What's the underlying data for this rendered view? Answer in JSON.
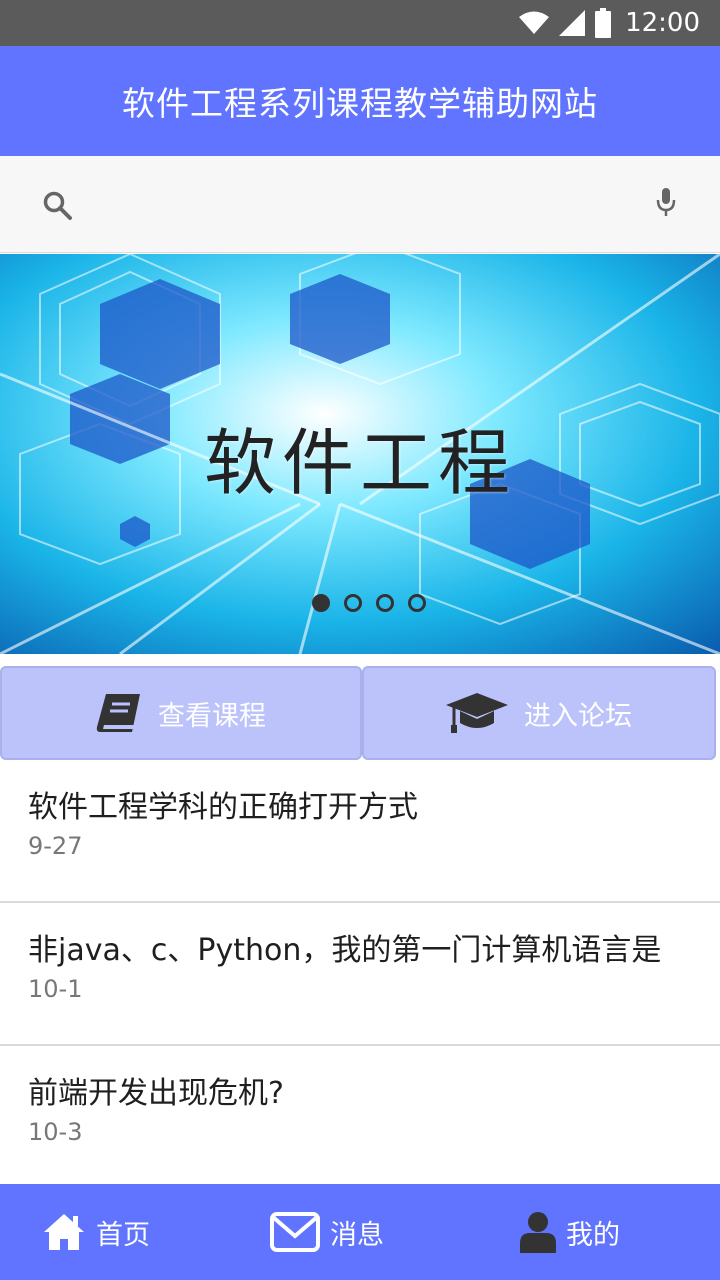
{
  "status_bar": {
    "time": "12:00"
  },
  "header": {
    "title": "软件工程系列课程教学辅助网站"
  },
  "search": {
    "placeholder": "",
    "value": ""
  },
  "banner": {
    "title": "软件工程",
    "slide_count": 4,
    "active_slide": 1
  },
  "actions": {
    "courses_label": "查看课程",
    "forum_label": "进入论坛"
  },
  "news": [
    {
      "headline": "软件工程学科的正确打开方式",
      "date": "9-27"
    },
    {
      "headline": "非java、c、Python，我的第一门计算机语言是",
      "date": "10-1"
    },
    {
      "headline": "前端开发出现危机?",
      "date": "10-3"
    }
  ],
  "bottom_nav": {
    "home_label": "首页",
    "messages_label": "消息",
    "me_label": "我的"
  },
  "colors": {
    "primary": "#6174ff",
    "action_button_bg": "#bcc3fb",
    "status_bar": "#5b5b5b"
  }
}
